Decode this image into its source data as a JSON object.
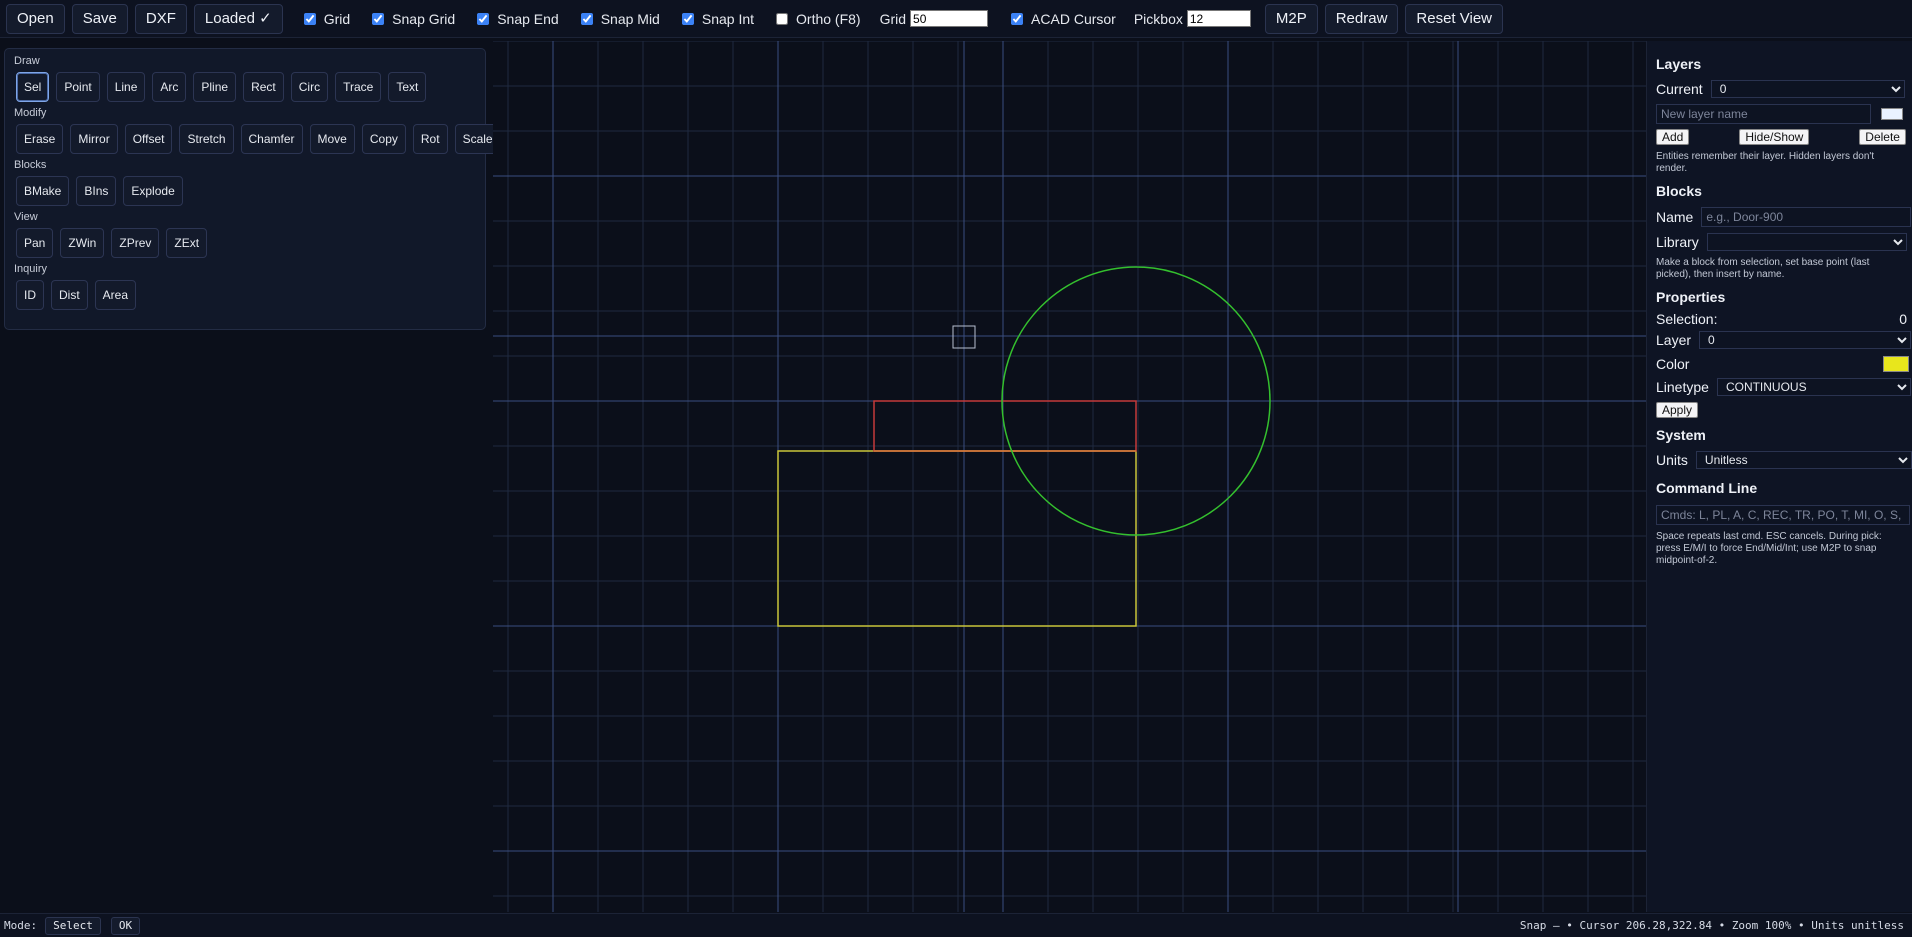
{
  "toolbar": {
    "open": "Open",
    "save": "Save",
    "dxf": "DXF",
    "loaded": "Loaded ✓",
    "checks": {
      "grid": {
        "label": "Grid",
        "checked": true
      },
      "snap_grid": {
        "label": "Snap Grid",
        "checked": true
      },
      "snap_end": {
        "label": "Snap End",
        "checked": true
      },
      "snap_mid": {
        "label": "Snap Mid",
        "checked": true
      },
      "snap_int": {
        "label": "Snap Int",
        "checked": true
      },
      "ortho": {
        "label": "Ortho (F8)",
        "checked": false
      },
      "acad_cursor": {
        "label": "ACAD Cursor",
        "checked": true
      }
    },
    "grid_label": "Grid",
    "grid_value": "50",
    "pickbox_label": "Pickbox",
    "pickbox_value": "12",
    "m2p": "M2P",
    "redraw": "Redraw",
    "reset_view": "Reset View"
  },
  "left_panel": {
    "draw": {
      "label": "Draw",
      "buttons": [
        "Sel",
        "Point",
        "Line",
        "Arc",
        "Pline",
        "Rect",
        "Circ",
        "Trace",
        "Text"
      ],
      "active": "Sel"
    },
    "modify": {
      "label": "Modify",
      "buttons": [
        "Erase",
        "Mirror",
        "Offset",
        "Stretch",
        "Chamfer",
        "Move",
        "Copy",
        "Rot",
        "Scale"
      ]
    },
    "blocks": {
      "label": "Blocks",
      "buttons": [
        "BMake",
        "BIns",
        "Explode"
      ]
    },
    "view": {
      "label": "View",
      "buttons": [
        "Pan",
        "ZWin",
        "ZPrev",
        "ZExt"
      ]
    },
    "inquiry": {
      "label": "Inquiry",
      "buttons": [
        "ID",
        "Dist",
        "Area"
      ]
    }
  },
  "right_panel": {
    "layers": {
      "title": "Layers",
      "current_label": "Current",
      "current_value": "0",
      "new_layer_placeholder": "New layer name",
      "new_layer_color": "#eaf2ff",
      "add": "Add",
      "hide_show": "Hide/Show",
      "delete": "Delete",
      "note": "Entities remember their layer. Hidden layers don't render."
    },
    "blocks": {
      "title": "Blocks",
      "name_label": "Name",
      "name_placeholder": "e.g., Door-900",
      "library_label": "Library",
      "library_value": "",
      "note": "Make a block from selection, set base point (last picked), then insert by name."
    },
    "properties": {
      "title": "Properties",
      "selection_label": "Selection:",
      "selection_value": "0",
      "layer_label": "Layer",
      "layer_value": "0",
      "color_label": "Color",
      "color_value": "#e8e61c",
      "linetype_label": "Linetype",
      "linetype_value": "CONTINUOUS",
      "apply": "Apply"
    },
    "system": {
      "title": "System",
      "units_label": "Units",
      "units_value": "Unitless"
    },
    "command_line": {
      "title": "Command Line",
      "placeholder": "Cmds: L, PL, A, C, REC, TR, PO, T, MI, O, S, CHA, M, CO, RO, SC",
      "note": "Space repeats last cmd. ESC cancels. During pick: press E/M/I to force End/Mid/Int; use M2P to snap midpoint-of-2."
    }
  },
  "status_bar": {
    "mode_label": "Mode:",
    "mode_value": "Select",
    "ok": "OK",
    "right_text": "Snap — • Cursor 206.28,322.84 • Zoom 100% • Units unitless"
  },
  "colors": {
    "grid_minor": "#1f2a40",
    "grid_major": "#3a4e80",
    "rect_yellow": "#c9c53a",
    "rect_red": "#c43a3a",
    "circle_green": "#34c02e",
    "rect_overlap_orange": "#d07a3a"
  }
}
